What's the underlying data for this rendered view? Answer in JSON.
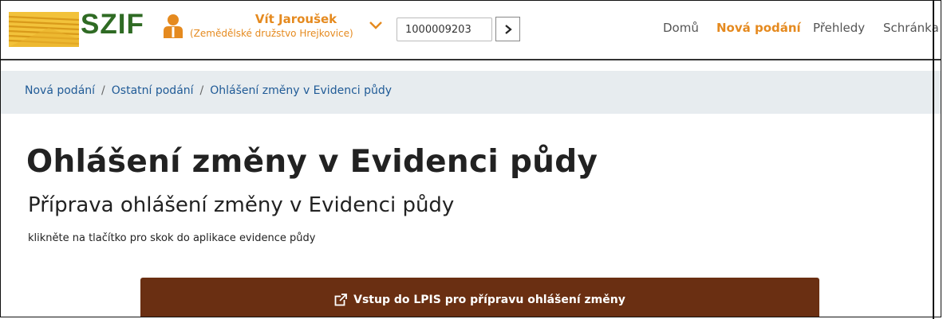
{
  "header": {
    "logo_text": "SZIF",
    "user_name": "Vít Jaroušek",
    "user_org": "(Zemědělské družstvo Hrejkovice)",
    "client_id_value": "1000009203",
    "nav": [
      "Domů",
      "Nová podání",
      "Přehledy",
      "Schránka"
    ],
    "nav_active_index": 1
  },
  "breadcrumb": [
    "Nová podání",
    "Ostatní podání",
    "Ohlášení změny v Evidenci půdy"
  ],
  "page": {
    "title": "Ohlášení změny v Evidenci půdy",
    "subtitle": "Příprava ohlášení změny v Evidenci půdy",
    "hint": "klikněte na tlačítko pro skok do aplikace evidence půdy",
    "cta_label": "Vstup do LPIS pro přípravu ohlášení změny",
    "cta_icon": "external-link-icon"
  },
  "colors": {
    "brand_green": "#2f6b24",
    "accent_orange": "#e58a1f",
    "link_blue": "#1f5a96",
    "breadcrumb_bg": "#e7ecef",
    "cta_brown": "#6a2f12"
  }
}
